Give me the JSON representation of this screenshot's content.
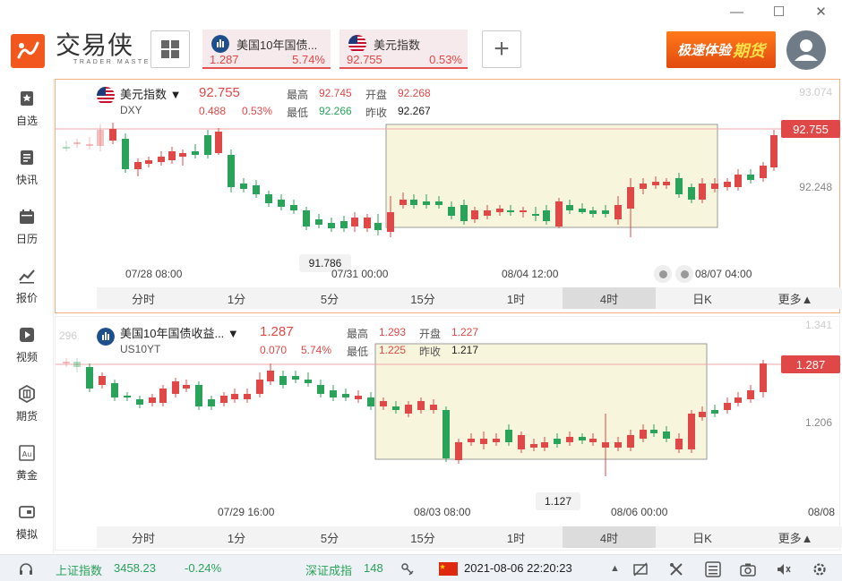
{
  "window": {
    "minimize": "—",
    "maximize": "☐",
    "close": "✕"
  },
  "brand": {
    "name": "交易侠",
    "subtitle": "TRADER MASTER"
  },
  "tabs": [
    {
      "name": "美国10年国债...",
      "price": "1.287",
      "pct": "5.74%"
    },
    {
      "name": "美元指数",
      "price": "92.755",
      "pct": "0.53%"
    }
  ],
  "add_tab": "+",
  "promo": {
    "text": "极速体验",
    "accent": "期货"
  },
  "sidebar": [
    {
      "label": "自选",
      "icon": "bookmark-icon"
    },
    {
      "label": "快讯",
      "icon": "news-icon"
    },
    {
      "label": "日历",
      "icon": "calendar-icon"
    },
    {
      "label": "报价",
      "icon": "quote-icon"
    },
    {
      "label": "视频",
      "icon": "video-icon"
    },
    {
      "label": "期货",
      "icon": "futures-icon"
    },
    {
      "label": "黄金",
      "icon": "gold-icon"
    },
    {
      "label": "模拟",
      "icon": "simulate-icon"
    }
  ],
  "timeframes": [
    "分时",
    "1分",
    "5分",
    "15分",
    "1时",
    "4时",
    "日K",
    "更多▲"
  ],
  "active_timeframe": "4时",
  "panels": {
    "dxy": {
      "name": "美元指数",
      "code": "DXY",
      "last": "92.755",
      "change": "0.488",
      "pct": "0.53%",
      "high_label": "最高",
      "high": "92.745",
      "open_label": "开盘",
      "open": "92.268",
      "low_label": "最低",
      "low": "92.266",
      "prev_label": "昨收",
      "prev": "92.267",
      "price_tag": "92.755",
      "min_tag": "91.786",
      "axis": [
        "93.074",
        "92.248"
      ],
      "xticks": [
        "07/28 08:00",
        "07/31 00:00",
        "08/04 12:00",
        "08/07 04:00"
      ]
    },
    "us10": {
      "name": "美国10年国债收益...",
      "code": "US10YT",
      "last": "1.287",
      "change": "0.070",
      "pct": "5.74%",
      "high_label": "最高",
      "high": "1.293",
      "open_label": "开盘",
      "open": "1.227",
      "low_label": "最低",
      "low": "1.225",
      "prev_label": "昨收",
      "prev": "1.217",
      "price_tag": "1.287",
      "min_tag": "1.127",
      "axis": [
        "1.341",
        "1.206"
      ],
      "left_axis": "296",
      "xticks": [
        "07/29 16:00",
        "08/03 08:00",
        "08/06 00:00",
        "08/08"
      ]
    }
  },
  "status": {
    "idx1_name": "上证指数",
    "idx1_value": "3458.23",
    "idx1_pct": "-0.24%",
    "idx2_name": "深证成指",
    "idx2_value": "148",
    "datetime": "2021-08-06 22:20:23"
  }
}
